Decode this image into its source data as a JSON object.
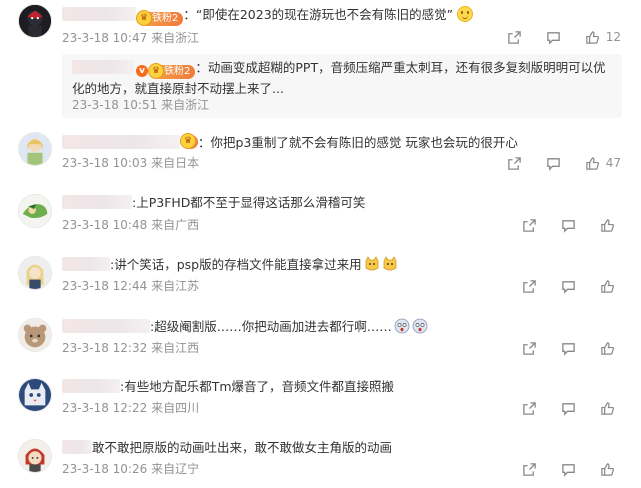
{
  "comments": [
    {
      "fan_label": "铁粉2",
      "text": "：“即使在2023的现在游玩也不会有陈旧的感觉”",
      "time": "23-3-18 10:47",
      "location": "来自浙江",
      "likes": "12",
      "reply": {
        "text": "：动画变成超糊的PPT，音频压缩严重太刺耳，还有很多复刻版明明可以优化的地方，就直接原封不动摆上来了...",
        "fan_label": "铁粉2",
        "time": "23-3-18 10:51",
        "location": "来自浙江"
      }
    },
    {
      "text": "：你把p3重制了就不会有陈旧的感觉 玩家也会玩的很开心",
      "time": "23-3-18 10:03",
      "location": "来自日本",
      "likes": "47"
    },
    {
      "text": ":上P3FHD都不至于显得这话那么滑稽可笑",
      "time": "23-3-18 10:48",
      "location": "来自广西",
      "likes": ""
    },
    {
      "text": ":讲个笑话，psp版的存档文件能直接拿过来用",
      "time": "23-3-18 12:44",
      "location": "来自江苏",
      "likes": ""
    },
    {
      "text": ":超级阉割版……你把动画加进去都行啊……",
      "time": "23-3-18 12:32",
      "location": "来自江西",
      "likes": ""
    },
    {
      "text": ":有些地方配乐都Tm爆音了，音频文件都直接照搬",
      "time": "23-3-18 12:22",
      "location": "来自四川",
      "likes": ""
    },
    {
      "text": "敢不敢把原版的动画吐出来，敢不敢做女主角版的动画",
      "time": "23-3-18 10:26",
      "location": "来自辽宁",
      "likes": ""
    }
  ]
}
